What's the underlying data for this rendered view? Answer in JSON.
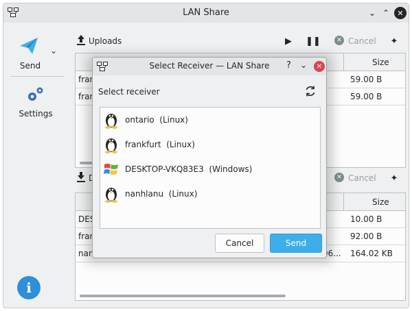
{
  "window": {
    "title": "LAN Share"
  },
  "sidebar": {
    "send_label": "Send",
    "settings_label": "Settings"
  },
  "uploads": {
    "label": "Uploads",
    "cancel_label": "Cancel",
    "size_header": "Size",
    "rows": [
      {
        "c1": "fran",
        "size": "59.00 B"
      },
      {
        "c1": "fran",
        "size": "59.00 B"
      }
    ]
  },
  "downloads": {
    "label": "D",
    "cancel_label": "Cancel",
    "size_header": "Size",
    "rows": [
      {
        "c1": "DES",
        "mid": "",
        "size": "10.00 B"
      },
      {
        "c1": "fran",
        "mid": "",
        "size": "92.00 B"
      },
      {
        "c1": "nan",
        "mid": "96...",
        "size": "164.02 KB"
      }
    ]
  },
  "dialog": {
    "title": "Select Receiver — LAN Share",
    "help_glyph": "?",
    "prompt": "Select receiver",
    "receivers": [
      {
        "name": "ontario",
        "os": "(Linux)",
        "icon": "linux-tux-icon"
      },
      {
        "name": "frankfurt",
        "os": "(Linux)",
        "icon": "linux-tux-icon"
      },
      {
        "name": "DESKTOP-VKQ83E3",
        "os": "(Windows)",
        "icon": "windows-logo-icon"
      },
      {
        "name": "nanhlanu",
        "os": "(Linux)",
        "icon": "linux-tux-icon"
      }
    ],
    "cancel_label": "Cancel",
    "send_label": "Send"
  },
  "colors": {
    "accent": "#3daee9",
    "close_red": "#da4453",
    "window_bg": "#eff0f1"
  }
}
